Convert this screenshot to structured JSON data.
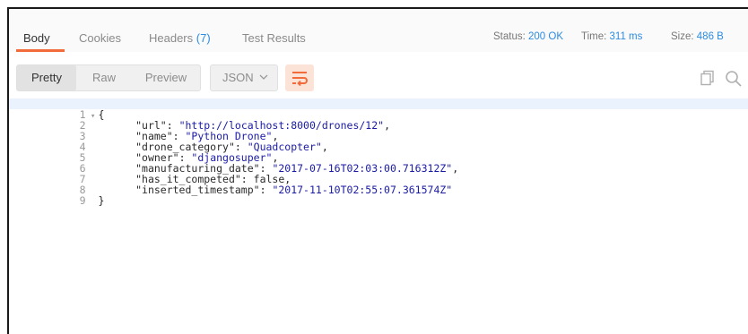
{
  "tabs": [
    {
      "label": "Body"
    },
    {
      "label": "Cookies"
    },
    {
      "label": "Headers",
      "count": "(7)"
    },
    {
      "label": "Test Results"
    }
  ],
  "status": {
    "status_label": "Status:",
    "status_value": "200 OK",
    "time_label": "Time:",
    "time_value": "311 ms",
    "size_label": "Size:",
    "size_value": "486 B"
  },
  "toolbar": {
    "views": [
      "Pretty",
      "Raw",
      "Preview"
    ],
    "format": "JSON",
    "icons": [
      "wrap-lines-icon",
      "copy-icon",
      "search-icon"
    ]
  },
  "colors": {
    "accent": "#f26b3a",
    "link_blue": "#2d8ce0",
    "string": "#1a1aa6"
  },
  "code": {
    "line_numbers": [
      "1",
      "2",
      "3",
      "4",
      "5",
      "6",
      "7",
      "8",
      "9"
    ],
    "open_brace": "{",
    "close_brace": "}",
    "fields": [
      {
        "key": "\"url\"",
        "value": "\"http://localhost:8000/drones/12\""
      },
      {
        "key": "\"name\"",
        "value": "\"Python Drone\""
      },
      {
        "key": "\"drone_category\"",
        "value": "\"Quadcopter\""
      },
      {
        "key": "\"owner\"",
        "value": "\"djangosuper\""
      },
      {
        "key": "\"manufacturing_date\"",
        "value": "\"2017-07-16T02:03:00.716312Z\""
      },
      {
        "key": "\"has_it_competed\"",
        "value": "false"
      },
      {
        "key": "\"inserted_timestamp\"",
        "value": "\"2017-11-10T02:55:07.361574Z\""
      }
    ]
  }
}
